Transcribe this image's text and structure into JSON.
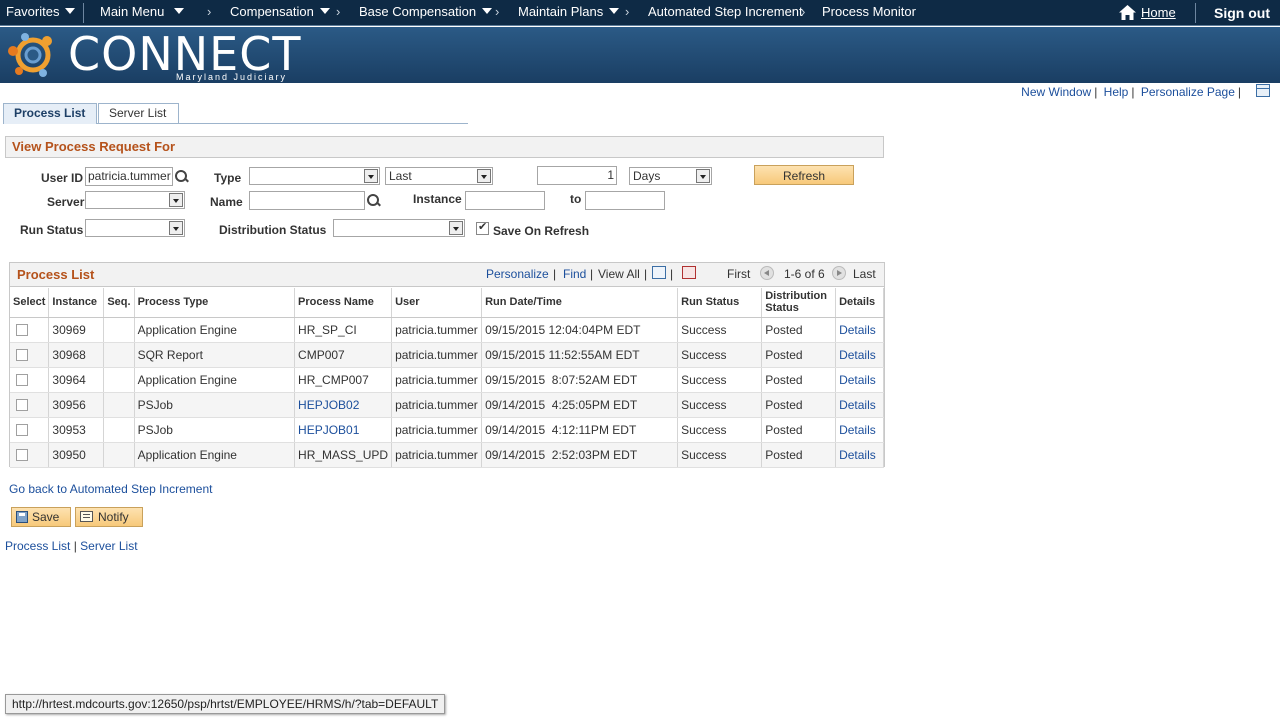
{
  "nav": {
    "favorites": "Favorites",
    "main_menu": "Main Menu",
    "crumbs": [
      "Compensation",
      "Base Compensation",
      "Maintain Plans",
      "Automated Step Increment",
      "Process Monitor"
    ],
    "home": "Home",
    "sign_out": "Sign out"
  },
  "banner": {
    "logo": "CONNECT",
    "sub": "Maryland Judiciary"
  },
  "util": {
    "new_window": "New Window",
    "help": "Help",
    "personalize_page": "Personalize Page"
  },
  "tabs": {
    "process_list": "Process List",
    "server_list": "Server List"
  },
  "filter": {
    "header": "View Process Request For",
    "user_id_label": "User ID",
    "user_id_value": "patricia.tummer",
    "type_label": "Type",
    "type_value": "",
    "last_value": "Last",
    "days_count": "1",
    "days_unit": "Days",
    "refresh": "Refresh",
    "server_label": "Server",
    "server_value": "",
    "name_label": "Name",
    "name_value": "",
    "instance_label": "Instance",
    "instance_from": "",
    "to_label": "to",
    "instance_to": "",
    "run_status_label": "Run Status",
    "run_status_value": "",
    "dist_status_label": "Distribution Status",
    "dist_status_value": "",
    "save_on_refresh": "Save On Refresh"
  },
  "grid": {
    "title": "Process List",
    "personalize": "Personalize",
    "find": "Find",
    "view_all": "View All",
    "first": "First",
    "range": "1-6 of 6",
    "last": "Last",
    "columns": [
      "Select",
      "Instance",
      "Seq.",
      "Process Type",
      "Process Name",
      "User",
      "Run Date/Time",
      "Run Status",
      "Distribution Status",
      "Details"
    ],
    "rows": [
      {
        "instance": "30969",
        "seq": "",
        "type": "Application Engine",
        "name": "HR_SP_CI",
        "user": "patricia.tummer",
        "date": "09/15/2015 12:04:04PM EDT",
        "status": "Success",
        "dist": "Posted",
        "details": "Details"
      },
      {
        "instance": "30968",
        "seq": "",
        "type": "SQR Report",
        "name": "CMP007",
        "user": "patricia.tummer",
        "date": "09/15/2015 11:52:55AM EDT",
        "status": "Success",
        "dist": "Posted",
        "details": "Details"
      },
      {
        "instance": "30964",
        "seq": "",
        "type": "Application Engine",
        "name": "HR_CMP007",
        "user": "patricia.tummer",
        "date": "09/15/2015  8:07:52AM EDT",
        "status": "Success",
        "dist": "Posted",
        "details": "Details"
      },
      {
        "instance": "30956",
        "seq": "",
        "type": "PSJob",
        "name": "HEPJOB02",
        "user": "patricia.tummer",
        "date": "09/14/2015  4:25:05PM EDT",
        "status": "Success",
        "dist": "Posted",
        "details": "Details"
      },
      {
        "instance": "30953",
        "seq": "",
        "type": "PSJob",
        "name": "HEPJOB01",
        "user": "patricia.tummer",
        "date": "09/14/2015  4:12:11PM EDT",
        "status": "Success",
        "dist": "Posted",
        "details": "Details"
      },
      {
        "instance": "30950",
        "seq": "",
        "type": "Application Engine",
        "name": "HR_MASS_UPD",
        "user": "patricia.tummer",
        "date": "09/14/2015  2:52:03PM EDT",
        "status": "Success",
        "dist": "Posted",
        "details": "Details"
      }
    ]
  },
  "footer": {
    "go_back": "Go back to Automated Step Increment",
    "save": "Save",
    "notify": "Notify",
    "process_list": "Process List",
    "server_list": "Server List"
  },
  "status_bar_url": "http://hrtest.mdcourts.gov:12650/psp/hrtst/EMPLOYEE/HRMS/h/?tab=DEFAULT"
}
